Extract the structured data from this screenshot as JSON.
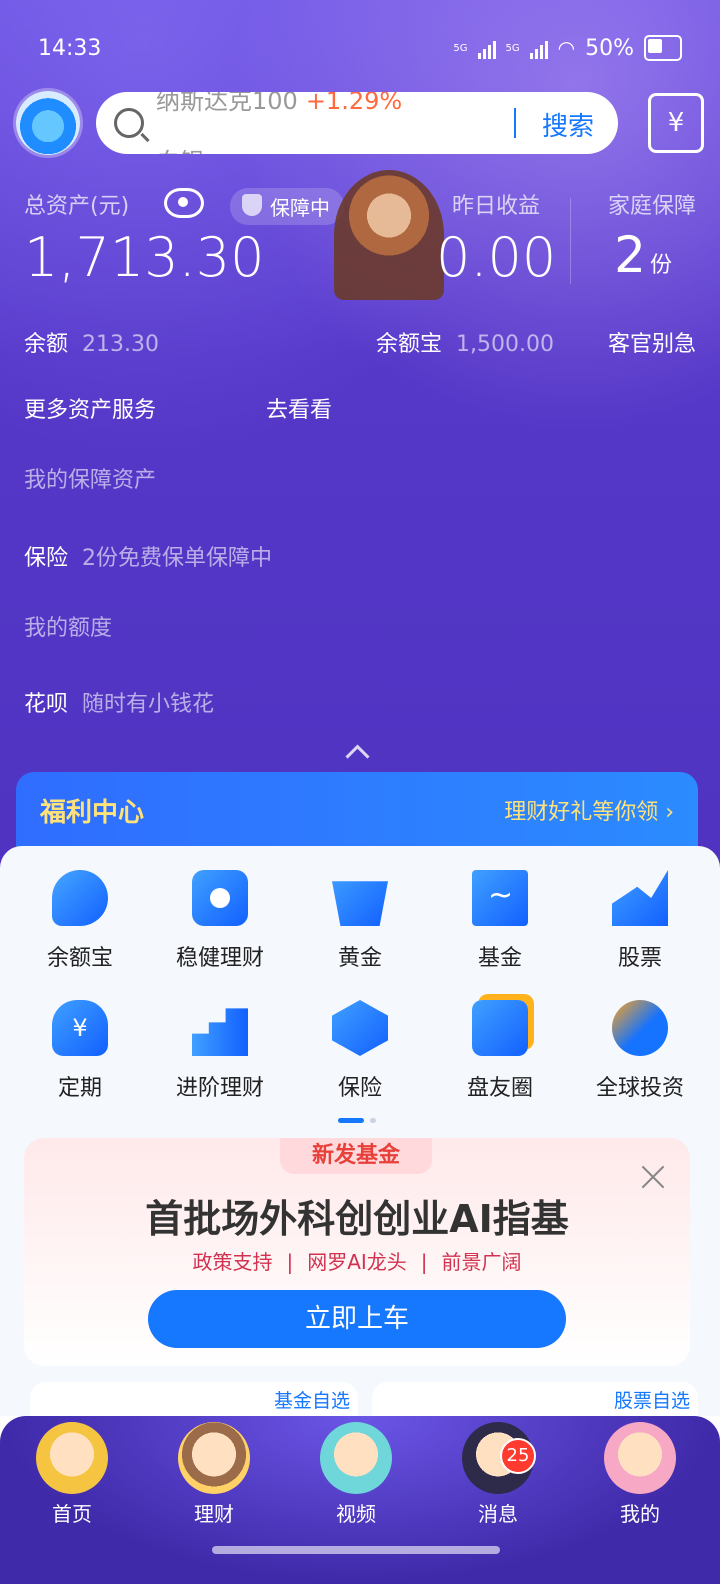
{
  "status_bar": {
    "time": "14:33",
    "network1": "5G",
    "network2": "5G",
    "battery": "50%"
  },
  "search": {
    "ticker_name": "纳斯达克100",
    "ticker_change": "+1.29%",
    "ticker_next": "白银",
    "button": "搜索"
  },
  "assets": {
    "total_label": "总资产(元)",
    "protect_label": "保障中",
    "total_value": "1,713.30",
    "yesterday_label": "昨日收益",
    "yesterday_value": "0.00",
    "family_label": "家庭保障",
    "family_value": "2",
    "family_unit": "份"
  },
  "rows": {
    "balance_key": "余额",
    "balance_val": "213.30",
    "yeb_key": "余额宝",
    "yeb_val": "1,500.00",
    "guest": "客官别急",
    "more_services": "更多资产服务",
    "go_see": "去看看",
    "my_protect": "我的保障资产",
    "insurance_key": "保险",
    "insurance_val": "2份免费保单保障中",
    "my_quota": "我的额度",
    "huabei_key": "花呗",
    "huabei_val": "随时有小钱花"
  },
  "welfare": {
    "title": "福利中心",
    "link": "理财好礼等你领 ›"
  },
  "grid": [
    {
      "label": "余额宝",
      "icon": "yuebao-icon"
    },
    {
      "label": "稳健理财",
      "icon": "bag-icon"
    },
    {
      "label": "黄金",
      "icon": "gold-icon"
    },
    {
      "label": "基金",
      "icon": "fund-icon"
    },
    {
      "label": "股票",
      "icon": "stock-icon"
    },
    {
      "label": "定期",
      "icon": "money-bag-icon"
    },
    {
      "label": "进阶理财",
      "icon": "bars-icon"
    },
    {
      "label": "保险",
      "icon": "hexagon-icon"
    },
    {
      "label": "盘友圈",
      "icon": "chat-icon"
    },
    {
      "label": "全球投资",
      "icon": "globe-icon"
    }
  ],
  "promo": {
    "tag": "新发基金",
    "title": "首批场外科创创业AI指基",
    "sub1": "政策支持",
    "sub2": "网罗AI龙头",
    "sub3": "前景广阔",
    "cta": "立即上车"
  },
  "cards": {
    "fund_watch": "基金自选",
    "stock_watch": "股票自选"
  },
  "tabs": [
    {
      "label": "首页"
    },
    {
      "label": "理财"
    },
    {
      "label": "视频"
    },
    {
      "label": "消息",
      "badge": "25"
    },
    {
      "label": "我的"
    }
  ],
  "colors": {
    "accent": "#1677ff",
    "header_purple": "#5638c9",
    "gold_text": "#ffe27a",
    "promo_red": "#d2324f"
  }
}
